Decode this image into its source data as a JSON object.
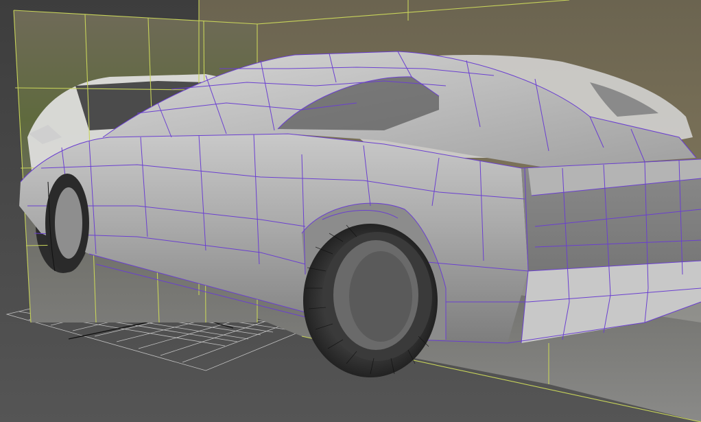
{
  "viewport": {
    "label": "",
    "colors": {
      "background": "#4a4a4a",
      "grid": "#d7d7d7",
      "plane_frame": "#c8d45a",
      "mesh_fill": "#a8a8a8",
      "mesh_wire": "#6a3fd0",
      "tire": "#2b2b2b"
    },
    "objects": [
      "reference-image-plane-side",
      "reference-image-plane-back",
      "ground-grid",
      "car-body-mesh",
      "rear-wheel-mesh",
      "front-wheel-mesh"
    ]
  }
}
